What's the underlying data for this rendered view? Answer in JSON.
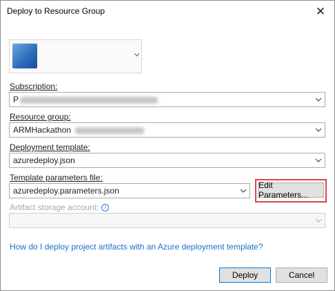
{
  "window": {
    "title": "Deploy to Resource Group",
    "close_glyph": "✕"
  },
  "account": {
    "name": "",
    "email": ""
  },
  "subscription": {
    "label": "Subscription:",
    "value": "P"
  },
  "resource_group": {
    "label": "Resource group:",
    "value": "ARMHackathon"
  },
  "deployment_template": {
    "label": "Deployment template:",
    "value": "azuredeploy.json"
  },
  "template_parameters": {
    "label": "Template parameters file:",
    "value": "azuredeploy.parameters.json",
    "edit_button": "Edit Parameters..."
  },
  "artifact_storage": {
    "label": "Artifact storage account:",
    "value": "",
    "info_glyph": "i"
  },
  "help_link": "How do I deploy project artifacts with an Azure deployment template?",
  "buttons": {
    "deploy": "Deploy",
    "cancel": "Cancel"
  },
  "colors": {
    "highlight": "#e1424a",
    "link": "#1a6fc9",
    "focus": "#0078d7"
  }
}
